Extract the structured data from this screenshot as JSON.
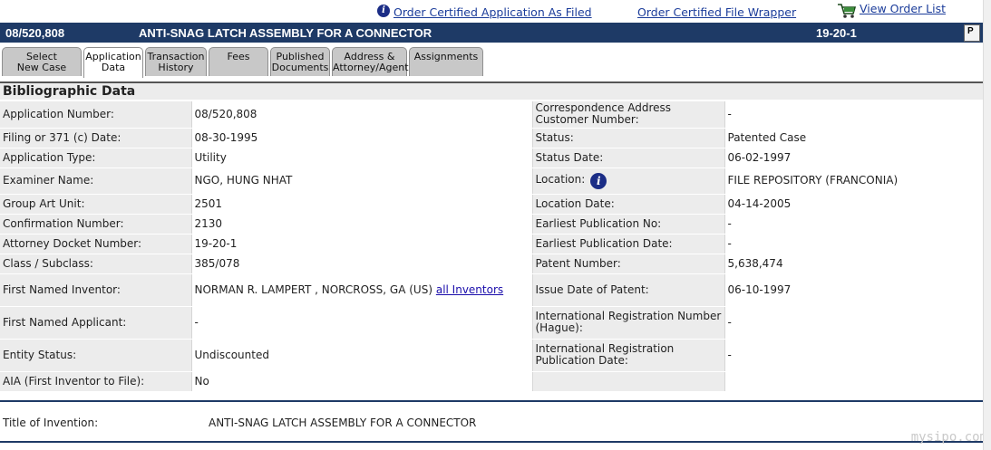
{
  "top_links": {
    "order_certified_application": "Order Certified Application As Filed",
    "order_certified_wrapper": "Order Certified File Wrapper",
    "view_order_list": "View Order List"
  },
  "titlebar": {
    "app_number": "08/520,808",
    "title": "ANTI-SNAG LATCH ASSEMBLY FOR A CONNECTOR",
    "docket": "19-20-1"
  },
  "tabs": [
    {
      "label": "Select New Case"
    },
    {
      "label": "Application Data"
    },
    {
      "label": "Transaction History"
    },
    {
      "label": "Fees"
    },
    {
      "label": "Published Documents"
    },
    {
      "label": "Address & Attorney/Agent"
    },
    {
      "label": "Assignments"
    }
  ],
  "section_title": "Bibliographic Data",
  "rows": [
    {
      "l1": "Application Number:",
      "v1": "08/520,808",
      "l2": "Correspondence Address Customer Number:",
      "v2": "-"
    },
    {
      "l1": "Filing or 371 (c) Date:",
      "v1": "08-30-1995",
      "l2": "Status:",
      "v2": "Patented Case"
    },
    {
      "l1": "Application Type:",
      "v1": "Utility",
      "l2": "Status Date:",
      "v2": "06-02-1997"
    },
    {
      "l1": "Examiner Name:",
      "v1": "NGO, HUNG NHAT",
      "l2": "Location:",
      "v2": "FILE REPOSITORY (FRANCONIA)"
    },
    {
      "l1": "Group Art Unit:",
      "v1": "2501",
      "l2": "Location Date:",
      "v2": "04-14-2005"
    },
    {
      "l1": "Confirmation Number:",
      "v1": "2130",
      "l2": "Earliest Publication No:",
      "v2": "-"
    },
    {
      "l1": "Attorney Docket Number:",
      "v1": "19-20-1",
      "l2": "Earliest Publication Date:",
      "v2": "-"
    },
    {
      "l1": "Class / Subclass:",
      "v1": "385/078",
      "l2": "Patent Number:",
      "v2": "5,638,474"
    },
    {
      "l1": "First Named Inventor:",
      "v1": "NORMAN R. LAMPERT , NORCROSS, GA (US)",
      "v1_link": "all Inventors",
      "l2": "Issue Date of Patent:",
      "v2": "06-10-1997"
    },
    {
      "l1": "First Named Applicant:",
      "v1": "-",
      "l2": "International Registration Number (Hague):",
      "v2": "-"
    },
    {
      "l1": "Entity Status:",
      "v1": "Undiscounted",
      "l2": "International Registration Publication Date:",
      "v2": "-"
    },
    {
      "l1": "AIA (First Inventor to File):",
      "v1": "No",
      "l2": "",
      "v2": ""
    }
  ],
  "invention": {
    "label": "Title of Invention:",
    "value": "ANTI-SNAG LATCH ASSEMBLY FOR A CONNECTOR"
  },
  "watermark": "mysipo.com",
  "colors": {
    "titlebar": "#1e3a66",
    "link": "#1b3c9a",
    "label_bg": "#ececec"
  }
}
